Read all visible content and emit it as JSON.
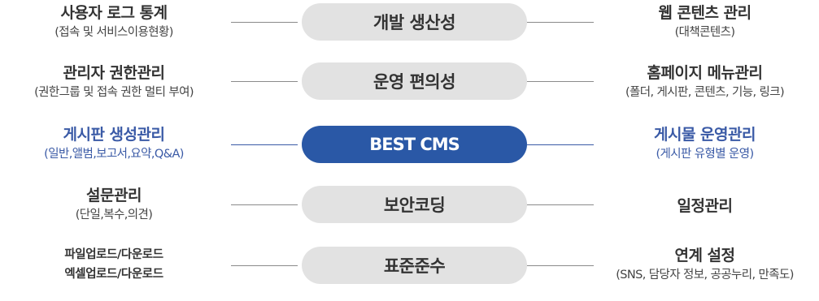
{
  "rows": [
    {
      "center": "개발 생산성",
      "left": {
        "title": "사용자 로그 통계",
        "sub": "(접속 및 서비스이용현황)"
      },
      "right": {
        "title": "웹 콘텐츠 관리",
        "sub": "(대책콘텐츠)"
      }
    },
    {
      "center": "운영 편의성",
      "left": {
        "title": "관리자 권한관리",
        "sub": "(권한그룹 및 접속 권한 멀티 부여)"
      },
      "right": {
        "title": "홈페이지 메뉴관리",
        "sub": "(폴더, 게시판, 콘텐츠, 기능, 링크)"
      }
    },
    {
      "center": "BEST CMS",
      "left": {
        "title": "게시판 생성관리",
        "sub": "(일반,앨범,보고서,요약,Q&A)"
      },
      "right": {
        "title": "게시물 운영관리",
        "sub": "(게시판 유형별 운영)"
      }
    },
    {
      "center": "보안코딩",
      "left": {
        "title": "설문관리",
        "sub": "(단일,복수,의견)"
      },
      "right": {
        "title": "일정관리"
      }
    },
    {
      "center": "표준준수",
      "left": {
        "lines": [
          "파일업로드/다운로드",
          "엑셀업로드/다운로드"
        ]
      },
      "right": {
        "title": "연계 설정",
        "sub": "(SNS, 담당자 정보, 공공누리, 만족도)"
      }
    }
  ],
  "colors": {
    "highlight_text": "#3a5aa6",
    "best_pill": "#2a58a6",
    "pill": "#e2e2e2",
    "connector": "#8a8a8a"
  }
}
